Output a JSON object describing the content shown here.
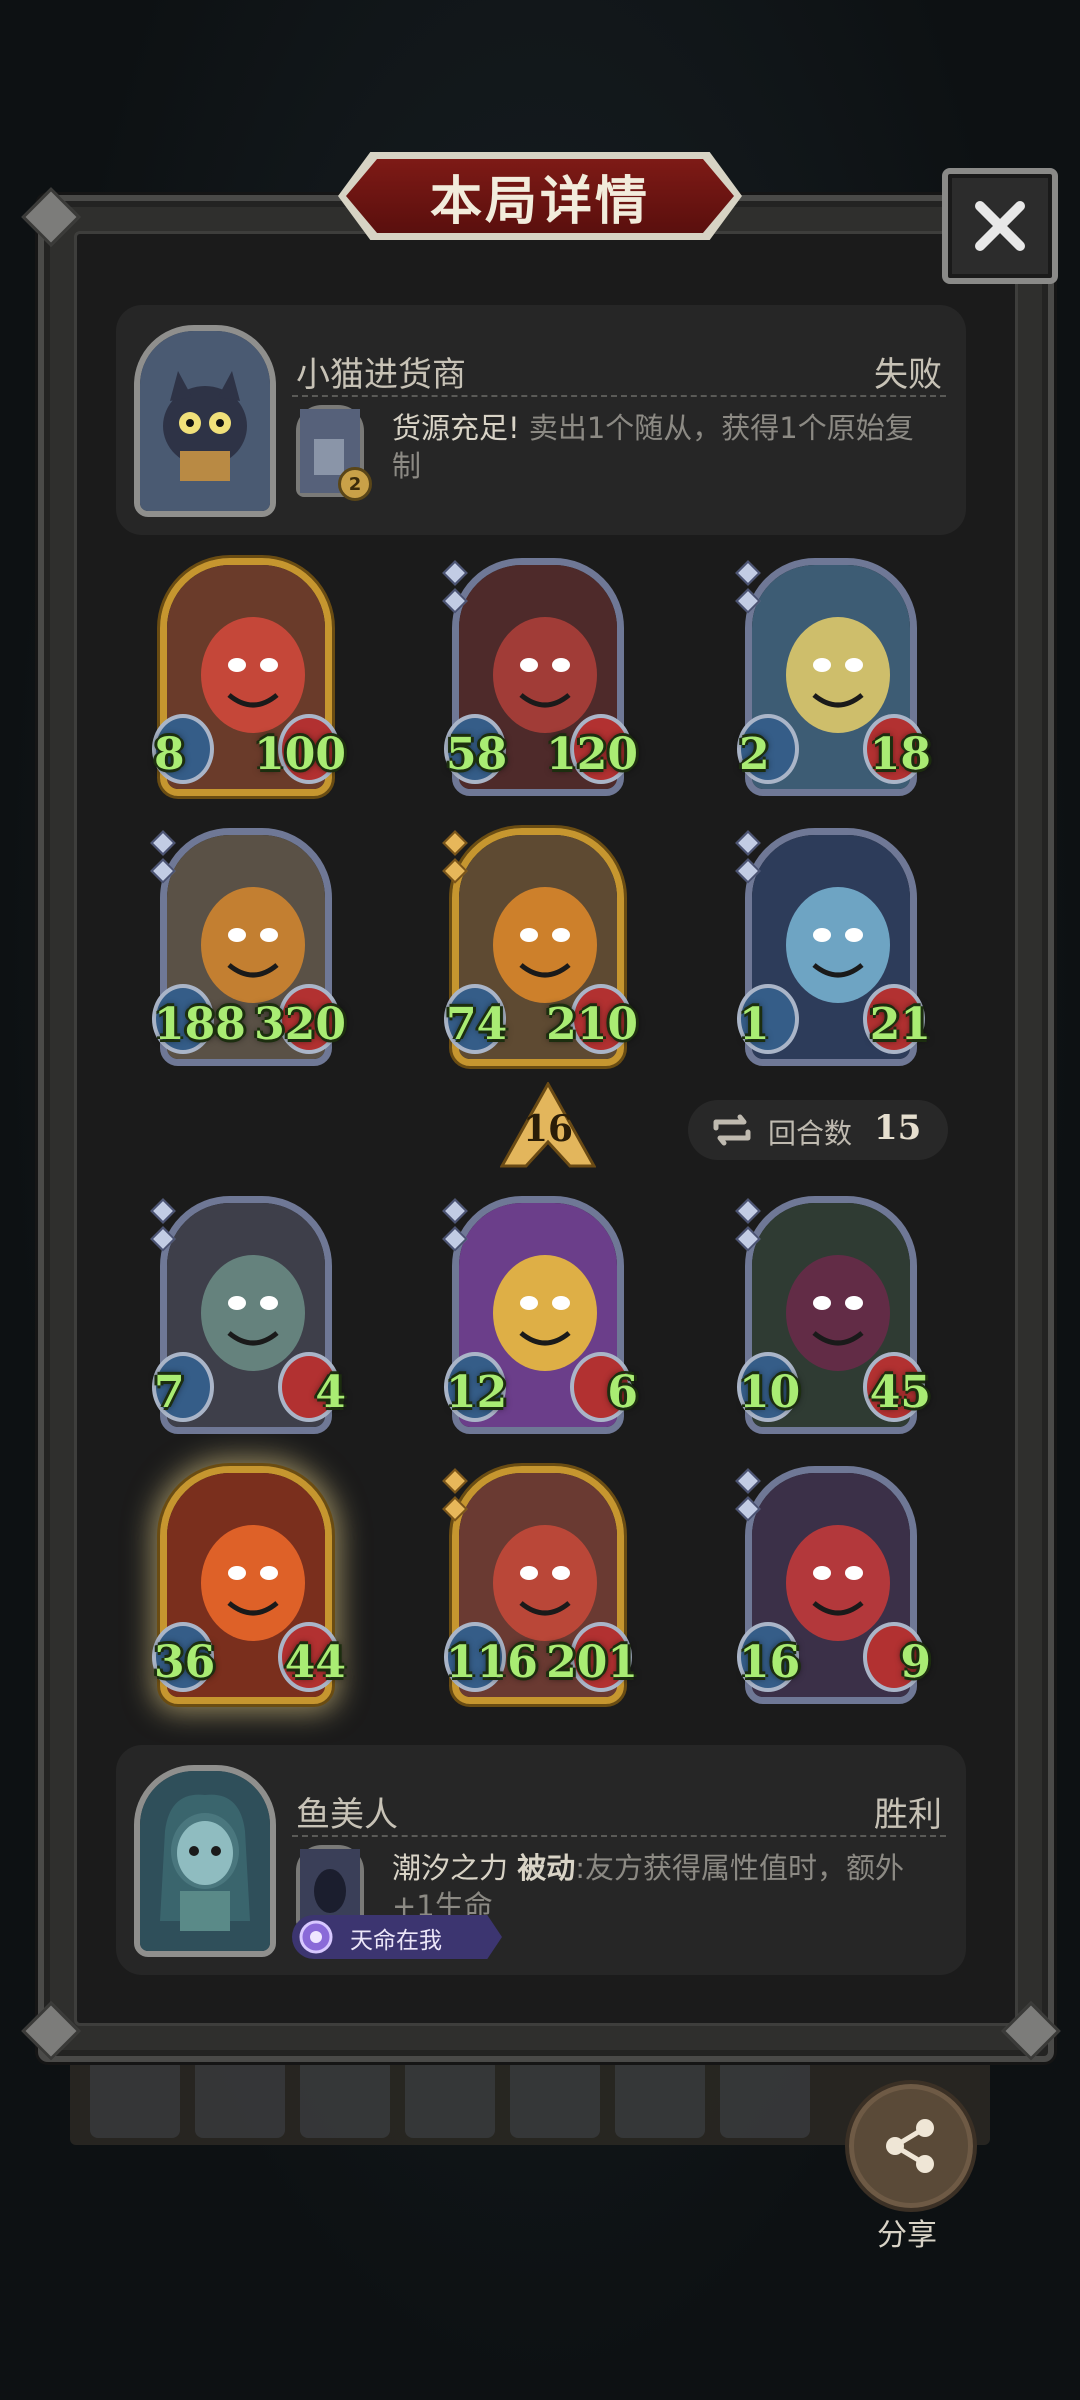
{
  "header": {
    "title": "本局详情"
  },
  "opponent": {
    "name": "小猫进货商",
    "result": "失败",
    "hero_level": "2",
    "power_name": "货源充足!",
    "power_desc": "卖出1个随从，获得1个原始复制"
  },
  "player": {
    "name": "鱼美人",
    "result": "胜利",
    "power_name": "潮汐之力",
    "power_type": "被动",
    "power_desc": ":友方获得属性值时，额外+1生命",
    "destiny_label": "天命在我"
  },
  "tavern_level": "16",
  "rounds": {
    "label": "回合数",
    "value": "15"
  },
  "opponent_minions": [
    {
      "atk": "8",
      "hp": "100",
      "frame": "gold",
      "art": "red-devil"
    },
    {
      "atk": "58",
      "hp": "120",
      "frame": "silver",
      "art": "dragon"
    },
    {
      "atk": "2",
      "hp": "18",
      "frame": "silver",
      "art": "fairy"
    },
    {
      "atk": "188",
      "hp": "320",
      "frame": "silver",
      "art": "pumpkins"
    },
    {
      "atk": "74",
      "hp": "210",
      "frame": "gold",
      "art": "pumpkin-ghost"
    },
    {
      "atk": "1",
      "hp": "21",
      "frame": "silver",
      "art": "elf-witch"
    }
  ],
  "player_minions": [
    {
      "atk": "7",
      "hp": "4",
      "frame": "silver",
      "art": "horned-elf"
    },
    {
      "atk": "12",
      "hp": "6",
      "frame": "silver",
      "art": "pirate"
    },
    {
      "atk": "10",
      "hp": "45",
      "frame": "silver",
      "art": "naga"
    },
    {
      "atk": "36",
      "hp": "44",
      "frame": "gold",
      "art": "fire-demon"
    },
    {
      "atk": "116",
      "hp": "201",
      "frame": "gold",
      "art": "red-golem"
    },
    {
      "atk": "16",
      "hp": "9",
      "frame": "silver",
      "art": "clown"
    }
  ],
  "share": {
    "label": "分享"
  },
  "colors": {
    "stat_green": "#a9ec73",
    "title_red": "#7e1a16",
    "gold_frame": "#c6962f"
  }
}
